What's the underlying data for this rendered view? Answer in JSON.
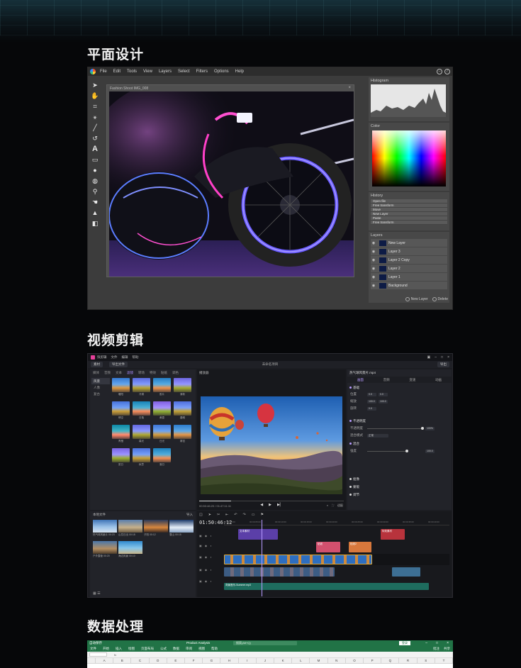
{
  "sections": {
    "graphic_design": "平面设计",
    "video_editing": "视频剪辑",
    "data_processing": "数据处理"
  },
  "photo_editor": {
    "menu": [
      "File",
      "Edit",
      "Tools",
      "View",
      "Layers",
      "Select",
      "Filters",
      "Options",
      "Help"
    ],
    "document_title": "Fashion Shoot IMG_008",
    "panels": {
      "histogram": "Histogram",
      "color": "Color",
      "history": "History",
      "layers": "Layers"
    },
    "history_items": [
      "Open file",
      "Free transform",
      "Move",
      "New Layer",
      "Paste",
      "Free transform"
    ],
    "layers": [
      "New Layer",
      "Layer 3",
      "Layer 2 Copy",
      "Layer 2",
      "Layer 1",
      "Background"
    ],
    "layer_actions": {
      "new": "New Layer",
      "delete": "Delete"
    }
  },
  "video_editor": {
    "title_menu": [
      "文件",
      "编辑",
      "帮助"
    ],
    "app_name": "快剪辑",
    "toolbar": {
      "import": "素材",
      "export": "导出文件",
      "project": "未命名项目",
      "publish": "导出"
    },
    "lib_tabs": [
      "媒体",
      "音频",
      "文本",
      "滤镜",
      "转场",
      "特效",
      "贴纸",
      "调色"
    ],
    "lib_active_tab": 3,
    "categories": [
      "风景",
      "人像",
      "复古"
    ],
    "effects": [
      "暖阳",
      "冷调",
      "胶片",
      "清新",
      "晴空",
      "日落",
      "黄昏",
      "晨曦",
      "青橙",
      "暮光",
      "日光",
      "雾霭",
      "夏日",
      "秋意",
      "落日"
    ],
    "player_header": "播放器",
    "player_time": "00:50:46:20 / 01:47:11:11",
    "player_fit": "适配",
    "props_header": "热气球风景片.mp4",
    "props_tabs": [
      "画面",
      "音频",
      "变速",
      "动画"
    ],
    "props_sections": [
      "基础",
      "不透明度",
      "混合",
      "抠像",
      "蒙版",
      "调节"
    ],
    "props_rows": {
      "position": {
        "label": "位置",
        "x": "0.0",
        "y": "0.0"
      },
      "scale": {
        "label": "缩放",
        "x": "100.0",
        "y": "100.0"
      },
      "rotation": {
        "label": "旋转",
        "value": "0.0"
      },
      "opacity": {
        "label": "不透明度",
        "value": "100%"
      },
      "blend": {
        "label": "混合模式",
        "value": "正常"
      },
      "intensity": {
        "label": "强度",
        "value": "100.0"
      }
    },
    "media_header": "本地文件",
    "media_add": "导入",
    "media_clips": [
      {
        "name": "热气球风景片",
        "dur": "00:23"
      },
      {
        "name": "山峦日出",
        "dur": "00:18"
      },
      {
        "name": "夕阳",
        "dur": "00:12"
      },
      {
        "name": "雪山",
        "dur": "00:15"
      },
      {
        "name": "户外露营",
        "dur": "00:20"
      },
      {
        "name": "海边风景",
        "dur": "00:10"
      }
    ],
    "timecode": "01:50:46:12",
    "ruler": [
      "00:00:00:00",
      "00:00:05:00",
      "00:00:10:00",
      "00:00:15:00",
      "00:00:20:00",
      "00:00:25:00",
      "00:00:30:00",
      "00:00:35:00",
      "00:00:40:00"
    ],
    "timeline_clips": {
      "purple": "文本素材",
      "red": "特效素材",
      "pink": "贴纸",
      "orange": "贴纸2",
      "audio": "背景音乐-Summer.mp3"
    }
  },
  "spreadsheet": {
    "app": "自动保存",
    "title": "Product Analysis",
    "search": "搜索(Alt+Q)",
    "signin": "登录",
    "ribbon": [
      "文件",
      "开始",
      "插入",
      "绘图",
      "页面布局",
      "公式",
      "数据",
      "审阅",
      "视图",
      "帮助"
    ],
    "comment": "批注",
    "share": "共享",
    "columns": [
      "A",
      "B",
      "C",
      "D",
      "E",
      "F",
      "G",
      "H",
      "I",
      "J",
      "K",
      "L",
      "M",
      "N",
      "O",
      "P",
      "Q",
      "R",
      "S",
      "T"
    ]
  }
}
